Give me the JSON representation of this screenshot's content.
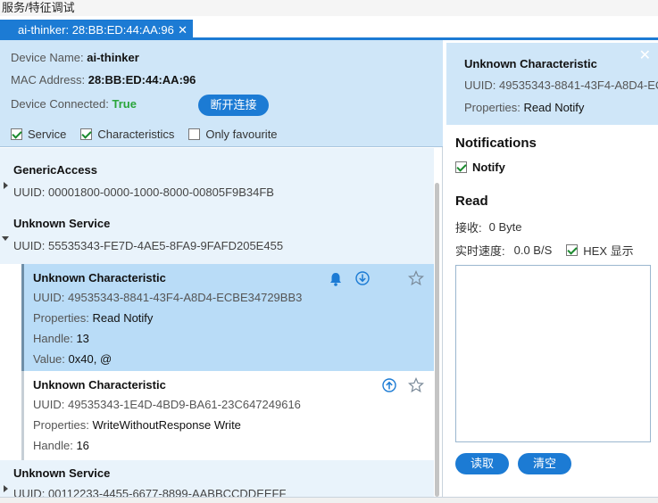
{
  "window": {
    "title": "服务/特征调试"
  },
  "tab": {
    "label": "ai-thinker: 28:BB:ED:44:AA:96",
    "close": "✕"
  },
  "device": {
    "name_label": "Device Name:",
    "name_value": "ai-thinker",
    "mac_label": "MAC Address:",
    "mac_value": "28:BB:ED:44:AA:96",
    "connected_label": "Device Connected:",
    "connected_value": "True",
    "disconnect_button": "断开连接"
  },
  "filters": [
    {
      "label": "Service",
      "checked": true
    },
    {
      "label": "Characteristics",
      "checked": true
    },
    {
      "label": "Only favourite",
      "checked": false
    }
  ],
  "services": [
    {
      "name": "GenericAccess",
      "uuid": "UUID: 00001800-0000-1000-8000-00805F9B34FB",
      "expanded": false
    },
    {
      "name": "Unknown Service",
      "uuid": "UUID: 55535343-FE7D-4AE5-8FA9-9FAFD205E455",
      "expanded": true,
      "characteristics": [
        {
          "name": "Unknown Characteristic",
          "uuid": "UUID: 49535343-8841-43F4-A8D4-ECBE34729BB3",
          "properties_label": "Properties:",
          "properties": "Read Notify",
          "handle_label": "Handle:",
          "handle": "13",
          "value_label": "Value:",
          "value": "0x40, @",
          "selected": true,
          "icons": [
            "bell-icon",
            "download-icon",
            "star-icon"
          ]
        },
        {
          "name": "Unknown Characteristic",
          "uuid": "UUID: 49535343-1E4D-4BD9-BA61-23C647249616",
          "properties_label": "Properties:",
          "properties": "WriteWithoutResponse Write",
          "handle_label": "Handle:",
          "handle": "16",
          "selected": false,
          "icons": [
            "upload-icon",
            "star-icon"
          ]
        }
      ]
    },
    {
      "name": "Unknown Service",
      "uuid": "UUID: 00112233-4455-6677-8899-AABBCCDDEEFF",
      "expanded": false
    }
  ],
  "detail": {
    "close": "✕",
    "title": "Unknown Characteristic",
    "uuid": "UUID: 49535343-8841-43F4-A8D4-EC",
    "properties_label": "Properties:",
    "properties": "Read Notify",
    "notifications_heading": "Notifications",
    "notify_label": "Notify",
    "notify_checked": true,
    "read_heading": "Read",
    "received_label": "接收:",
    "received_value": "0 Byte",
    "speed_label": "实时速度:",
    "speed_value": "0.0 B/S",
    "hex_label": "HEX 显示",
    "hex_checked": true,
    "read_button": "读取",
    "clear_button": "清空"
  },
  "colors": {
    "accent": "#1c7bd4",
    "panel": "#cfe6f8",
    "selected": "#b9dcf7",
    "ok": "#2aa53a"
  }
}
